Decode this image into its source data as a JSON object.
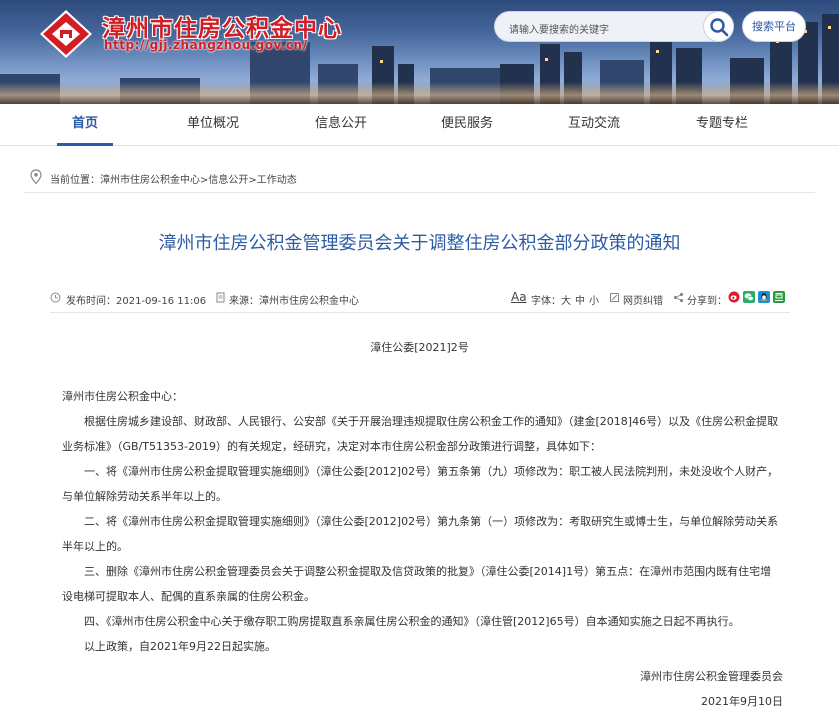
{
  "header": {
    "site_title": "漳州市住房公积金中心",
    "site_url": "http://gjj.zhangzhou.gov.cn/",
    "search_placeholder": "请输入要搜索的关键字",
    "search_platform_label": "搜索平台",
    "logo_icon": "housing-fund-logo-icon",
    "search_icon": "search-icon",
    "brand_color": "#d41c24"
  },
  "nav": {
    "items": [
      "首页",
      "单位概况",
      "信息公开",
      "便民服务",
      "互动交流",
      "专题专栏"
    ],
    "active_index": 0,
    "active_color": "#2a5aa8"
  },
  "breadcrumb": {
    "text": "当前位置：漳州市住房公积金中心>信息公开>工作动态",
    "icon": "location-pin-icon"
  },
  "article": {
    "title": "漳州市住房公积金管理委员会关于调整住房公积金部分政策的通知",
    "title_color": "#2d5ba6",
    "meta": {
      "publish_time": "发布时间：2021-09-16 11:06",
      "source": "来源：漳州市住房公积金中心",
      "font_size_label": "字体：",
      "font_sizes": [
        "大",
        "中",
        "小"
      ],
      "error_report": "网页纠错",
      "share_label": "分享到："
    },
    "doc_number": "漳住公委[2021]2号",
    "salutation": "漳州市住房公积金中心：",
    "paragraphs": [
      "根据住房城乡建设部、财政部、人民银行、公安部《关于开展治理违规提取住房公积金工作的通知》（建金[2018]46号）以及《住房公积金提取业务标准》（GB/T51353-2019）的有关规定，经研究，决定对本市住房公积金部分政策进行调整，具体如下：",
      "一、将《漳州市住房公积金提取管理实施细则》（漳住公委[2012]02号）第五条第（九）项修改为：职工被人民法院判刑，未处没收个人财产，与单位解除劳动关系半年以上的。",
      "二、将《漳州市住房公积金提取管理实施细则》（漳住公委[2012]02号）第九条第（一）项修改为：考取研究生或博士生，与单位解除劳动关系半年以上的。",
      "三、删除《漳州市住房公积金管理委员会关于调整公积金提取及信贷政策的批复》（漳住公委[2014]1号）第五点：在漳州市范围内既有住宅增设电梯可提取本人、配偶的直系亲属的住房公积金。",
      "四、《漳州市住房公积金中心关于缴存职工购房提取直系亲属住房公积金的通知》（漳住管[2012]65号）自本通知实施之日起不再执行。",
      "以上政策，自2021年9月22日起实施。"
    ],
    "signature": "漳州市住房公积金管理委员会",
    "date": "2021年9月10日"
  }
}
